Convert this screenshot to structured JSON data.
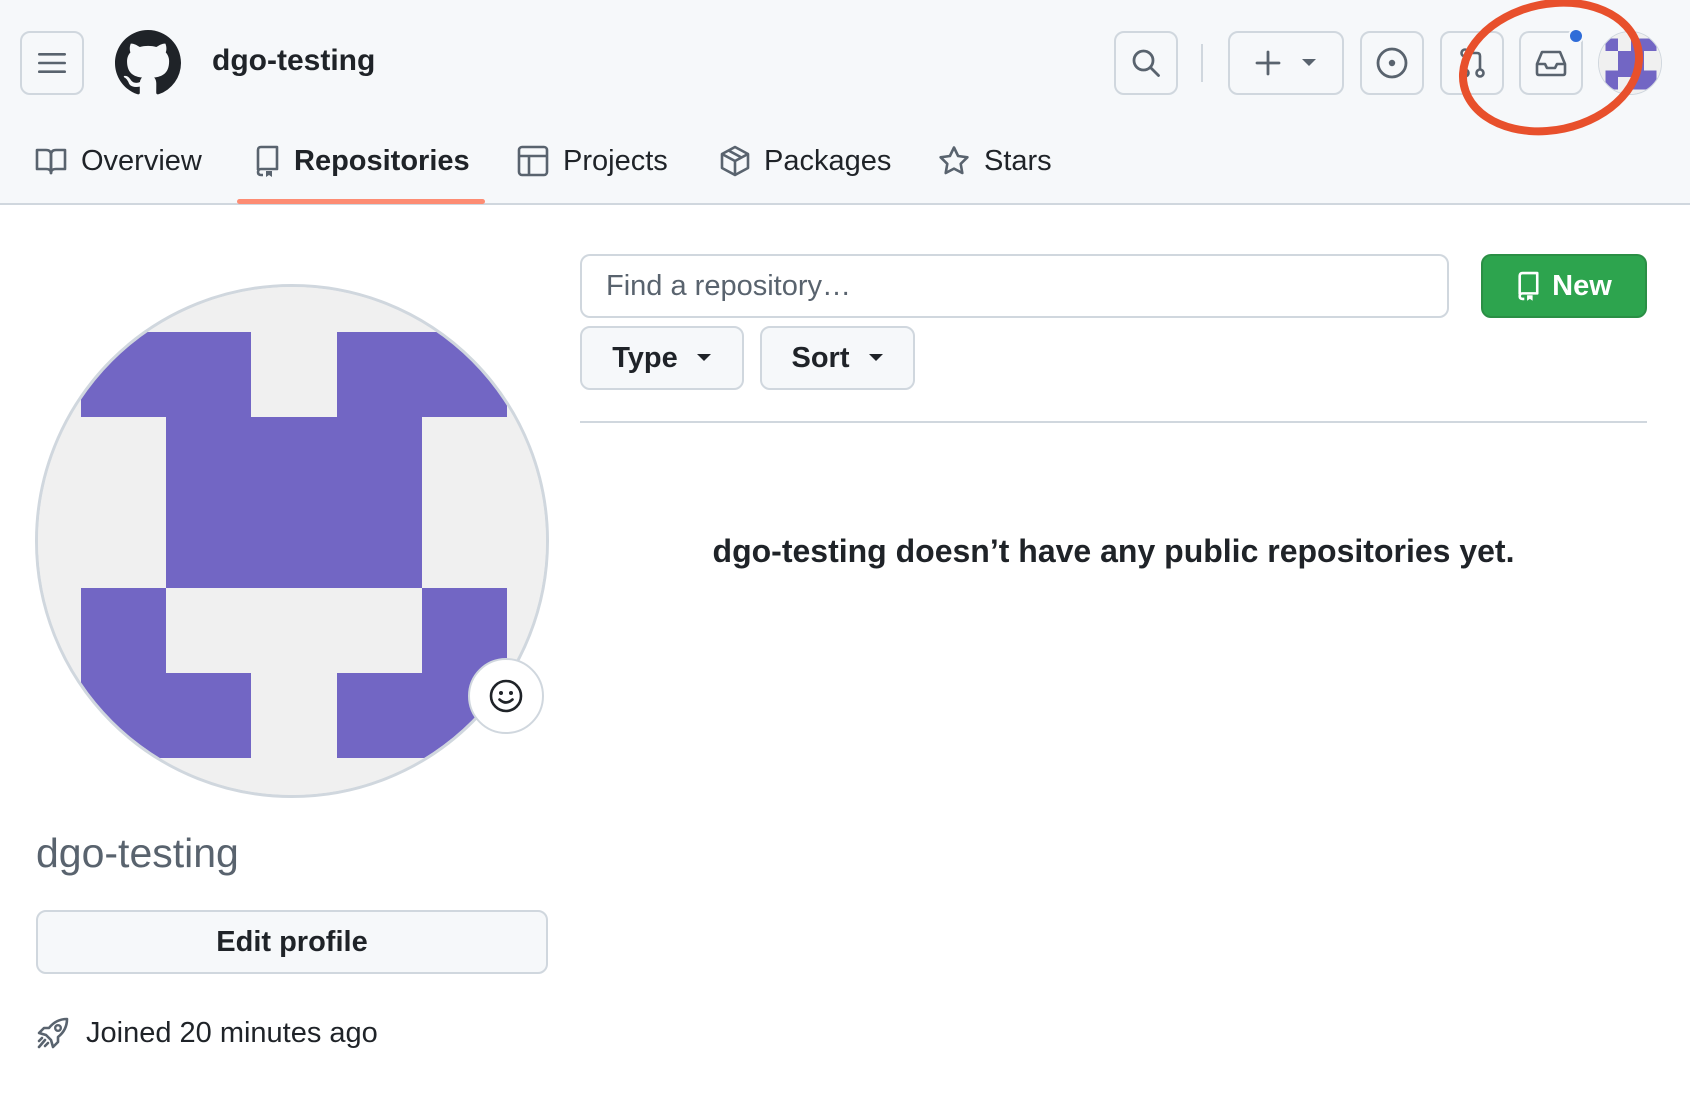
{
  "header": {
    "username": "dgo-testing",
    "notification_dot_color": "#2f6cd8",
    "annotation_color": "#e8502c",
    "icons": {
      "menu": "hamburger-icon",
      "logo": "github-mark-icon",
      "search": "search-icon",
      "create": "plus-icon",
      "issues": "issue-opened-icon",
      "pulls": "git-pull-request-icon",
      "inbox": "inbox-icon"
    }
  },
  "tabs": [
    {
      "label": "Overview",
      "icon": "book-icon",
      "selected": false
    },
    {
      "label": "Repositories",
      "icon": "repo-icon",
      "selected": true
    },
    {
      "label": "Projects",
      "icon": "table-icon",
      "selected": false
    },
    {
      "label": "Packages",
      "icon": "package-icon",
      "selected": false
    },
    {
      "label": "Stars",
      "icon": "star-icon",
      "selected": false
    }
  ],
  "profile": {
    "login": "dgo-testing",
    "edit_button": "Edit profile",
    "joined": "Joined 20 minutes ago",
    "avatar_color": "#7266c4",
    "avatar_bg": "#f0f0f0"
  },
  "repositories": {
    "search_placeholder": "Find a repository…",
    "new_button": "New",
    "type_filter": "Type",
    "sort_filter": "Sort",
    "empty_message": "dgo-testing doesn’t have any public repositories yet."
  }
}
